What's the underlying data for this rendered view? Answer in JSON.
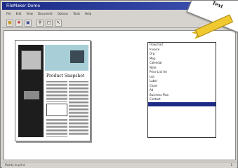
{
  "window": {
    "title": "FileMaker Demo"
  },
  "menu": [
    "File",
    "Edit",
    "View",
    "Document",
    "Options",
    "Tools",
    "Help"
  ],
  "toolbar": [
    "open",
    "close",
    "save",
    "zoom",
    "fit",
    "tool"
  ],
  "document": {
    "headline": "Product Snapshot"
  },
  "listbox": {
    "items": [
      "Flowchart",
      "Invoice",
      "Org",
      "Map",
      "Calendar",
      "Note",
      "Price List Ad",
      "List",
      "Label",
      "Chart",
      "Ad",
      "Business Plan",
      "Contact",
      ""
    ],
    "selected_index": 13
  },
  "ribbon": {
    "corner_text": "Text"
  },
  "status": {
    "left": "Ready to print",
    "right": "1"
  }
}
